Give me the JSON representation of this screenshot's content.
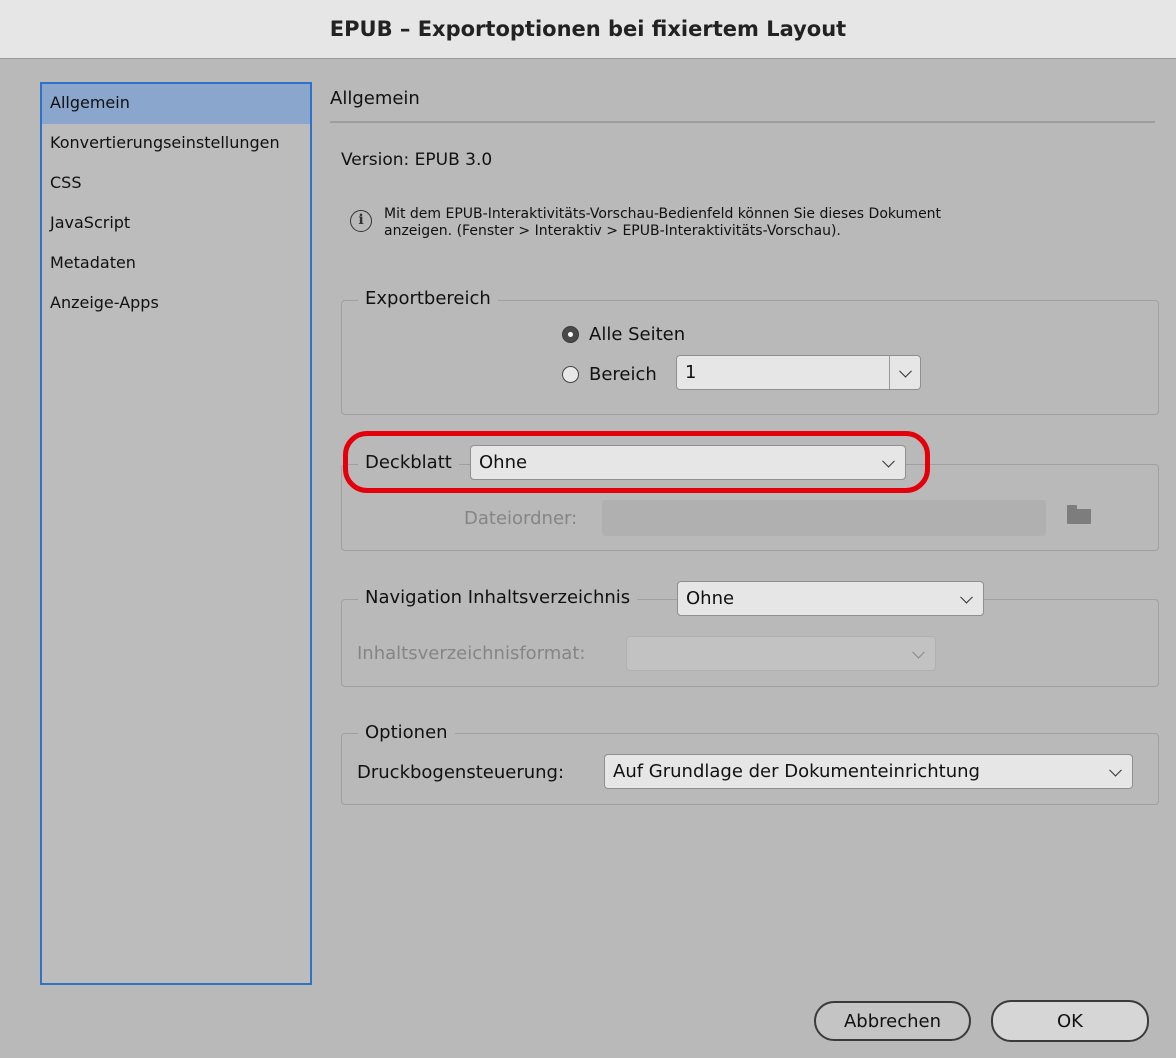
{
  "window": {
    "title": "EPUB – Exportoptionen bei fixiertem Layout"
  },
  "sidebar": {
    "items": [
      {
        "label": "Allgemein",
        "selected": true
      },
      {
        "label": "Konvertierungseinstellungen",
        "selected": false
      },
      {
        "label": "CSS",
        "selected": false
      },
      {
        "label": "JavaScript",
        "selected": false
      },
      {
        "label": "Metadaten",
        "selected": false
      },
      {
        "label": "Anzeige-Apps",
        "selected": false
      }
    ]
  },
  "main": {
    "title": "Allgemein",
    "version": "Version: EPUB 3.0",
    "info": {
      "icon": "info-icon",
      "line1": "Mit dem EPUB-Interaktivitäts-Vorschau-Bedienfeld können Sie dieses Dokument",
      "line2": "anzeigen. (Fenster > Interaktiv > EPUB-Interaktivitäts-Vorschau)."
    },
    "export_range": {
      "legend": "Exportbereich",
      "all_pages_label": "Alle Seiten",
      "all_pages_checked": true,
      "range_label": "Bereich",
      "range_checked": false,
      "range_value": "1"
    },
    "cover": {
      "label": "Deckblatt",
      "value": "Ohne",
      "folder_label": "Dateiordner:",
      "folder_value": "",
      "highlight_color": "#e3000b"
    },
    "toc": {
      "label": "Navigation Inhaltsverzeichnis",
      "value": "Ohne",
      "format_label": "Inhaltsverzeichnisformat:",
      "format_value": ""
    },
    "options": {
      "legend": "Optionen",
      "spread_label": "Druckbogensteuerung:",
      "spread_value": "Auf Grundlage der Dokumenteinrichtung"
    }
  },
  "buttons": {
    "cancel": "Abbrechen",
    "ok": "OK"
  }
}
